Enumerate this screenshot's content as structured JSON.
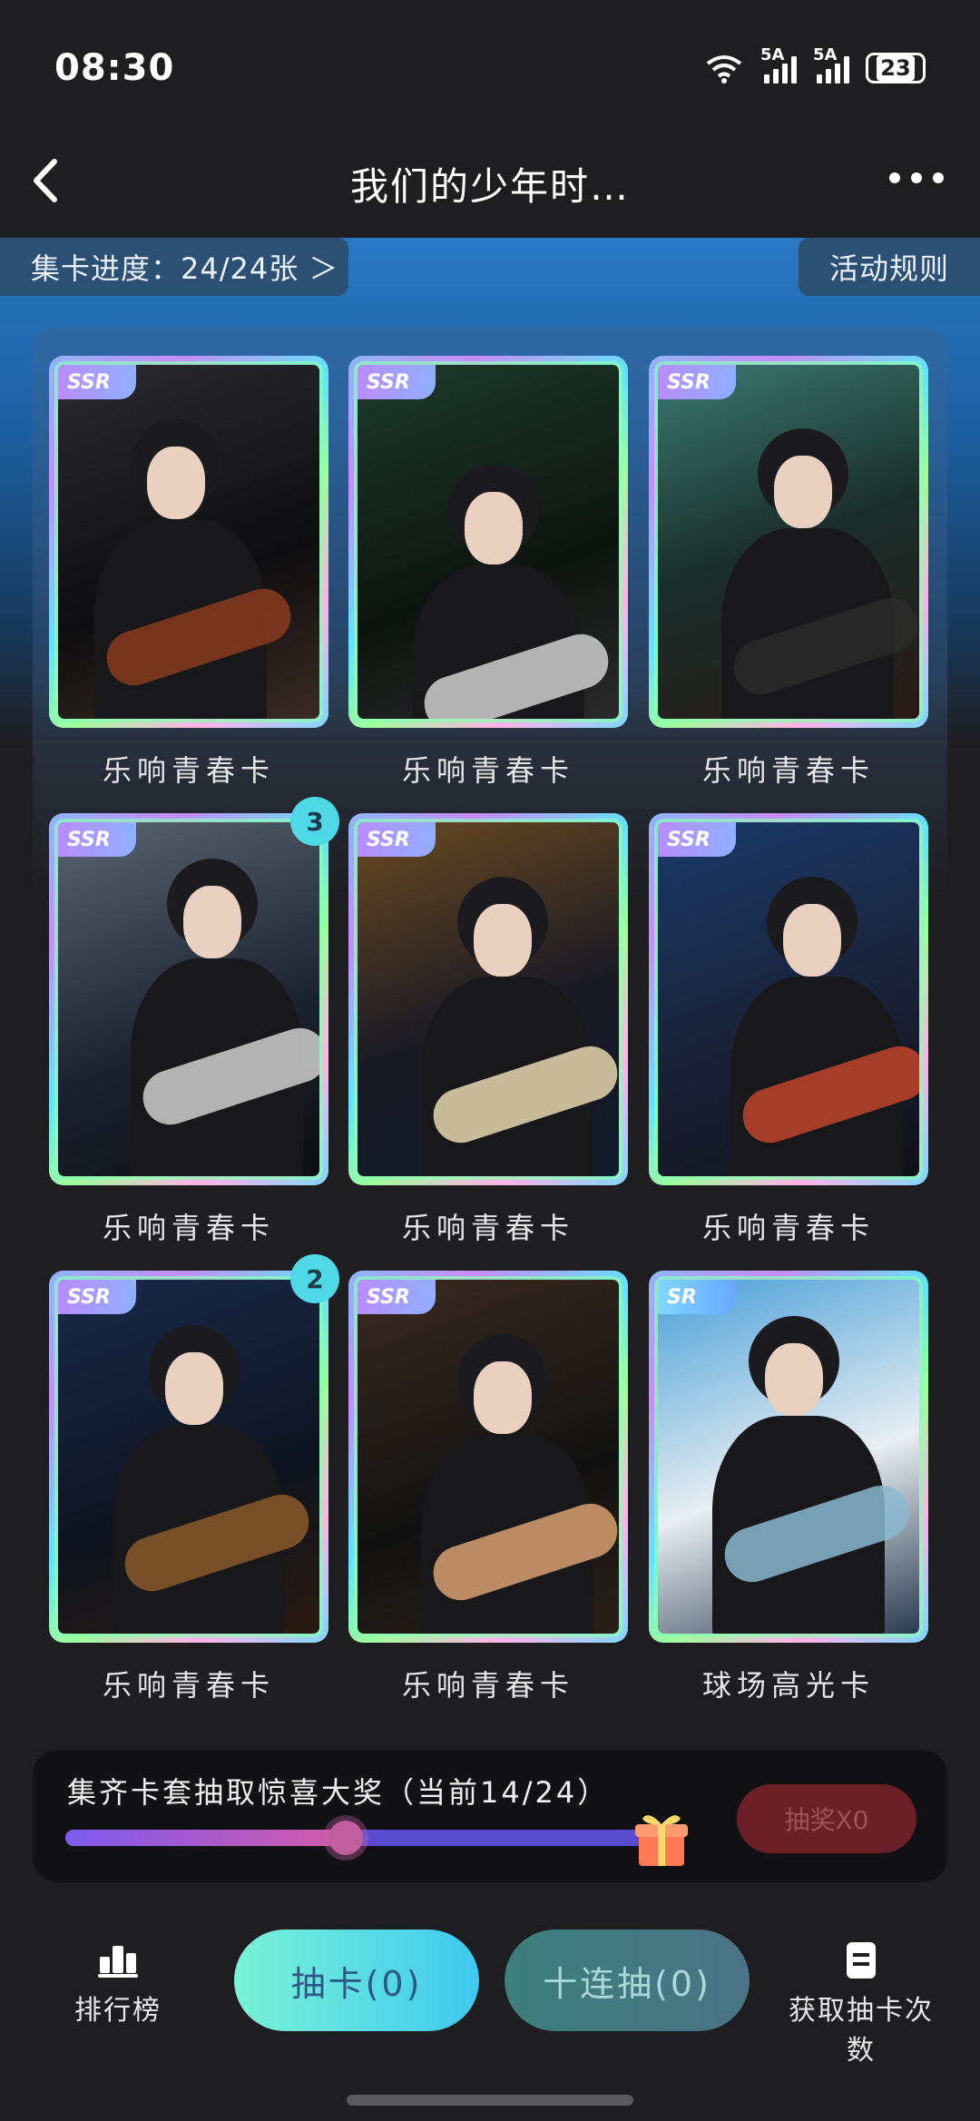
{
  "status_bar": {
    "time": "08:30",
    "signal1": "5A",
    "signal2": "5A",
    "battery": "23"
  },
  "header": {
    "title": "我们的少年时…"
  },
  "progress": {
    "label": "集卡进度：24/24张 ＞"
  },
  "rules": {
    "label": "活动规则"
  },
  "cards": [
    {
      "rarity": "SSR",
      "label": "乐响青春卡",
      "count": ""
    },
    {
      "rarity": "SSR",
      "label": "乐响青春卡",
      "count": ""
    },
    {
      "rarity": "SSR",
      "label": "乐响青春卡",
      "count": ""
    },
    {
      "rarity": "SSR",
      "label": "乐响青春卡",
      "count": "3"
    },
    {
      "rarity": "SSR",
      "label": "乐响青春卡",
      "count": ""
    },
    {
      "rarity": "SSR",
      "label": "乐响青春卡",
      "count": ""
    },
    {
      "rarity": "SSR",
      "label": "乐响青春卡",
      "count": "2"
    },
    {
      "rarity": "SSR",
      "label": "乐响青春卡",
      "count": ""
    },
    {
      "rarity": "SR",
      "label": "球场高光卡",
      "count": ""
    }
  ],
  "reward": {
    "text": "集齐卡套抽取惊喜大奖（当前14/24）",
    "progress_fraction": 0.583,
    "button": "抽奖X0"
  },
  "bottom": {
    "rank_label": "排行榜",
    "draw_label": "抽卡(0)",
    "draw10_label": "十连抽(0)",
    "get_label": "获取抽卡次数"
  },
  "colors": {
    "accent_cyan": "#4fd9e6",
    "banner_blue": "#2a78c4",
    "reward_button": "#6b1f26"
  }
}
